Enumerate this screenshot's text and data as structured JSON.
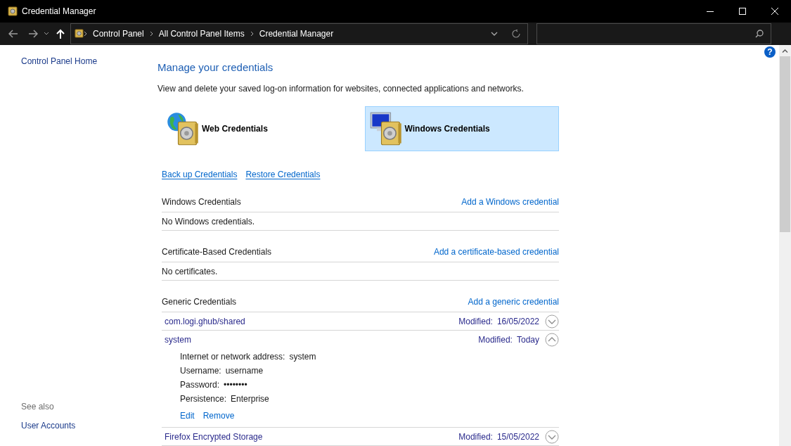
{
  "window": {
    "title": "Credential Manager"
  },
  "address_bar": {
    "breadcrumbs": [
      "Control Panel",
      "All Control Panel Items",
      "Credential Manager"
    ]
  },
  "help": "?",
  "sidebar": {
    "home_link": "Control Panel Home",
    "see_also_heading": "See also",
    "see_also_links": [
      "User Accounts"
    ]
  },
  "main": {
    "title": "Manage your credentials",
    "description": "View and delete your saved log-on information for websites, connected applications and networks.",
    "credential_types": [
      {
        "kind": "web",
        "label": "Web Credentials",
        "selected": false
      },
      {
        "kind": "windows",
        "label": "Windows Credentials",
        "selected": true
      }
    ],
    "actions": [
      "Back up Credentials",
      "Restore Credentials"
    ],
    "sections": [
      {
        "title": "Windows Credentials",
        "add_link": "Add a Windows credential",
        "empty_text": "No Windows credentials."
      },
      {
        "title": "Certificate-Based Credentials",
        "add_link": "Add a certificate-based credential",
        "empty_text": "No certificates."
      },
      {
        "title": "Generic Credentials",
        "add_link": "Add a generic credential",
        "items": [
          {
            "name": "com.logi.ghub/shared",
            "modified_label": "Modified:",
            "modified": "16/05/2022",
            "expanded": false
          },
          {
            "name": "system",
            "modified_label": "Modified:",
            "modified": "Today",
            "expanded": true,
            "details": [
              {
                "label": "Internet or network address:",
                "value": "system"
              },
              {
                "label": "Username:",
                "value": "username"
              },
              {
                "label": "Password:",
                "value": "••••••••"
              },
              {
                "label": "Persistence:",
                "value": "Enterprise"
              }
            ],
            "links": [
              "Edit",
              "Remove"
            ]
          },
          {
            "name": "Firefox Encrypted Storage",
            "modified_label": "Modified:",
            "modified": "15/05/2022",
            "expanded": false
          }
        ]
      }
    ]
  }
}
